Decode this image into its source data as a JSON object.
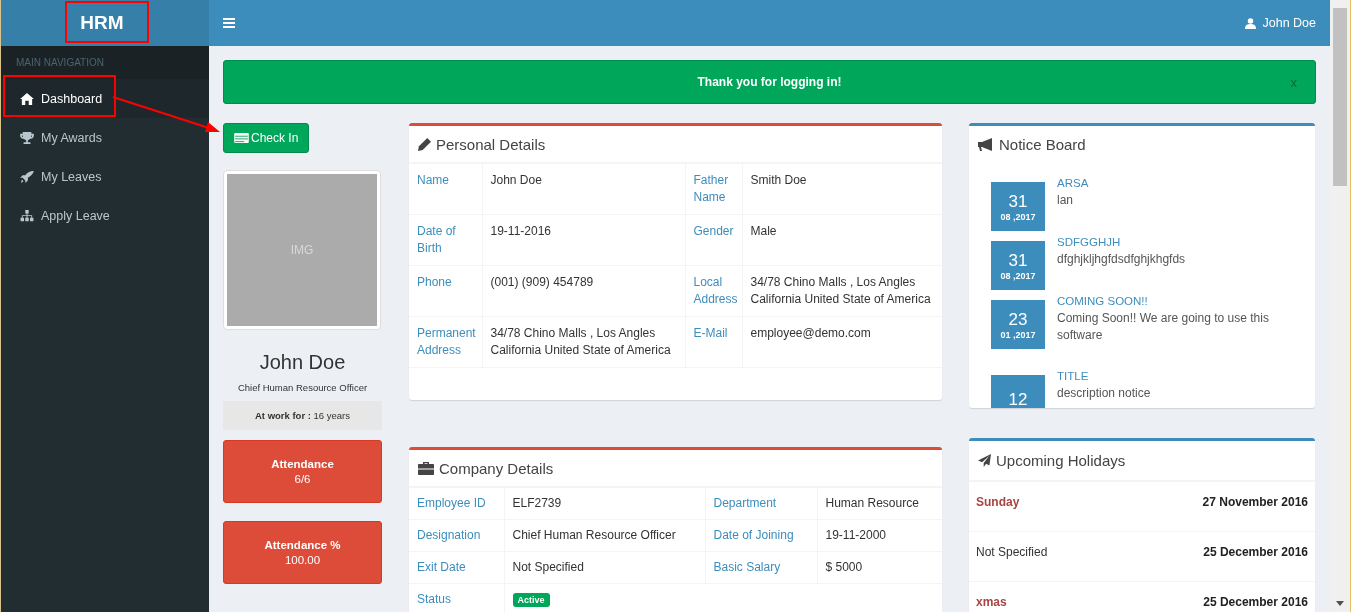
{
  "brand": "HRM",
  "header": {
    "user": "John Doe"
  },
  "sidebar": {
    "heading": "MAIN NAVIGATION",
    "items": [
      {
        "label": "Dashboard",
        "selected": true
      },
      {
        "label": "My Awards",
        "selected": false
      },
      {
        "label": "My Leaves",
        "selected": false
      },
      {
        "label": "Apply Leave",
        "selected": false
      }
    ]
  },
  "alert": {
    "message": "Thank you for logging in!",
    "close": "x"
  },
  "check_in": {
    "label": "Check In"
  },
  "profile": {
    "photo_label": "IMG",
    "name": "John Doe",
    "title": "Chief Human Resource Officer",
    "tenure_label": "At work for :",
    "tenure_value": "16 years"
  },
  "stats": [
    {
      "label": "Attendance",
      "value": "6/6"
    },
    {
      "label": "Attendance %",
      "value": "100.00"
    }
  ],
  "personal_details": {
    "title": "Personal Details",
    "rows": [
      [
        {
          "label": "Name",
          "value": "John Doe"
        },
        {
          "label": "Father Name",
          "value": "Smith Doe"
        }
      ],
      [
        {
          "label": "Date of Birth",
          "value": "19-11-2016"
        },
        {
          "label": "Gender",
          "value": "Male"
        }
      ],
      [
        {
          "label": "Phone",
          "value": "(001) (909) 454789"
        },
        {
          "label": "Local Address",
          "value": "34/78 Chino Malls , Los Angles California United State of America"
        }
      ],
      [
        {
          "label": "Permanent Address",
          "value": "34/78 Chino Malls , Los Angles California United State of America"
        },
        {
          "label": "E-Mail",
          "value": "employee@demo.com"
        }
      ]
    ]
  },
  "company_details": {
    "title": "Company Details",
    "rows": [
      [
        {
          "label": "Employee ID",
          "value": "ELF2739",
          "kind": "text"
        },
        {
          "label": "Department",
          "value": "Human Resource",
          "kind": "text"
        }
      ],
      [
        {
          "label": "Designation",
          "value": "Chief Human Resource Officer",
          "kind": "text"
        },
        {
          "label": "Date of Joining",
          "value": "19-11-2000",
          "kind": "text"
        }
      ],
      [
        {
          "label": "Exit Date",
          "value": "Not Specified",
          "kind": "text"
        },
        {
          "label": "Basic Salary",
          "value": "$ 5000",
          "kind": "text"
        }
      ],
      [
        {
          "label": "Status",
          "value": "Active",
          "kind": "badge"
        }
      ]
    ]
  },
  "notice_board": {
    "title": "Notice Board",
    "notices": [
      {
        "day": "31",
        "month_year": "08 ,2017",
        "title": "ARSA",
        "description": "lan"
      },
      {
        "day": "31",
        "month_year": "08 ,2017",
        "title": "SDFGGHJH",
        "description": "dfghjkljhgfdsdfghjkhgfds"
      },
      {
        "day": "23",
        "month_year": "01 ,2017",
        "title": "COMING SOON!!",
        "description": "Coming Soon!! We are going to use this software"
      },
      {
        "day": "12",
        "title": "TITLE",
        "description": "description notice"
      }
    ]
  },
  "upcoming_holidays": {
    "title": "Upcoming Holidays",
    "holidays": [
      {
        "name": "Sunday",
        "date": "27 November 2016",
        "kind": "named"
      },
      {
        "name": "Not Specified",
        "date": "25 December 2016",
        "kind": "unnamed"
      },
      {
        "name": "xmas",
        "date": "25 December 2016",
        "kind": "named"
      }
    ]
  }
}
